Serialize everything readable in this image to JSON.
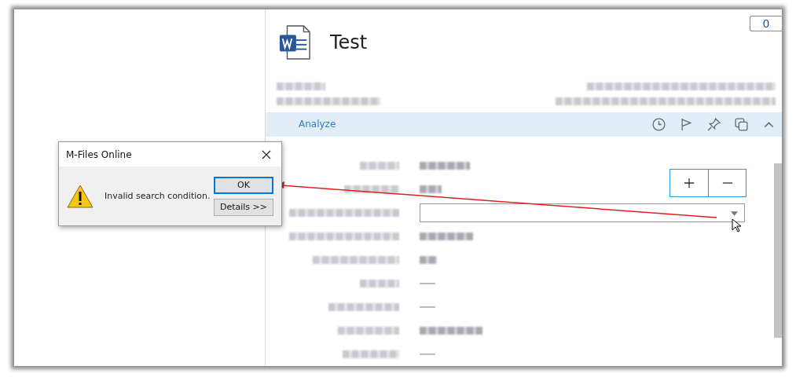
{
  "document": {
    "title": "Test",
    "comment_count": "0"
  },
  "toolbar": {
    "action": "Analyze"
  },
  "properties": [
    {
      "kind": "text"
    },
    {
      "kind": "text"
    },
    {
      "kind": "field"
    },
    {
      "kind": "text"
    },
    {
      "kind": "text"
    },
    {
      "kind": "dash"
    },
    {
      "kind": "dash"
    },
    {
      "kind": "text"
    },
    {
      "kind": "dash"
    }
  ],
  "dialog": {
    "title": "M-Files Online",
    "message": "Invalid search condition.",
    "buttons": [
      {
        "label": "OK",
        "selected": true
      },
      {
        "label": "Details >>",
        "selected": false
      }
    ]
  }
}
